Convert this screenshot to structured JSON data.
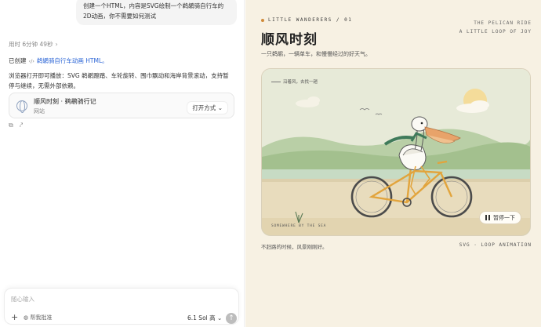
{
  "chat": {
    "user_message_line1": "创建一个HTML，内容是SVG绘制一个鹈鹕骑自行车的2D动画，你不需要如何测试",
    "elapsed": "用时 6分钟 49秒",
    "elapsed_chevron": "›",
    "created_prefix": "已创建",
    "created_link": "鹈鹕骑自行车动画 HTML。",
    "description": "浏览器打开即可播放：SVG 鹈鹕蹬踏、车轮旋转、围巾飘动和海岸背景滚动，支持暂停与继续，无需外部依赖。",
    "card_title": "顺风时刻 · 鹈鹕骑行记",
    "card_subtitle": "网站",
    "open_with": "打开方式",
    "composer_placeholder": "随心输入",
    "approve_label": "帮我批准",
    "model_label": "6.1 Sol 高",
    "plus": "+",
    "send": "↑"
  },
  "preview": {
    "kicker": "LITTLE WANDERERS / 01",
    "right_line1": "THE PELICAN RIDE",
    "right_line2": "A LITTLE LOOP OF JOY",
    "title": "顺风时刻",
    "subtitle": "一只鹈鹕，一辆单车，和慢慢经过的好天气。",
    "scene_note": "沿着风，去找一趟",
    "scene_brand": "SOMEWHERE BY THE SEA",
    "pause_label": "暂停一下",
    "footer_left": "不赶路的时候，风景刚刚好。",
    "footer_right": "SVG · LOOP ANIMATION"
  },
  "colors": {
    "page_bg": "#f7f1e3",
    "sky": "#e7ead8",
    "hills": "#b9cfa6",
    "sand": "#e8dcbd",
    "bike": "#e2a43c",
    "scarf": "#3f7a5a",
    "beak": "#e8a36a",
    "link": "#2a64d6"
  }
}
